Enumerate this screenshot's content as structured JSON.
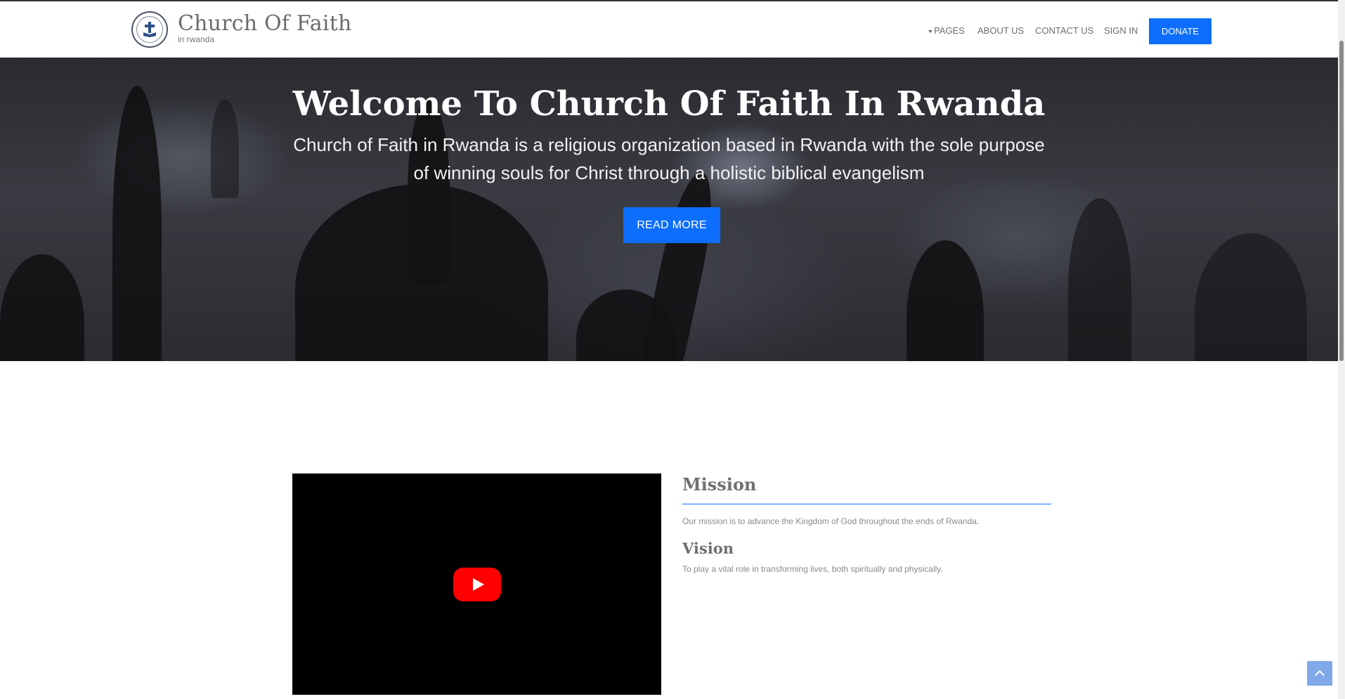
{
  "brand": {
    "title": "Church Of Faith",
    "subtitle": "in rwanda"
  },
  "nav": {
    "pages_label": "Pages",
    "about_label": "About us",
    "contact_label": "Contact us",
    "signin_label": "Sign in",
    "donate_label": "Donate"
  },
  "hero": {
    "title": "Welcome To Church Of Faith In Rwanda",
    "text": "Church of Faith in Rwanda is a religious organization based in Rwanda with the sole purpose of winning souls for Christ through a holistic biblical evangelism",
    "button_label": "Read more"
  },
  "about": {
    "mission_heading": "Mission",
    "mission_text": "Our mission is to advance the Kingdom of God throughout the ends of Rwanda.",
    "vision_heading": "Vision",
    "vision_text": "To play a vital role in transforming lives, both spiritually and physically."
  },
  "colors": {
    "accent": "#0d6efd",
    "youtube_red": "#ff0000",
    "back_to_top": "#7fa9e8"
  },
  "icons": {
    "logo": "church-logo-icon",
    "pages_caret": "caret-down-icon",
    "video_play": "youtube-play-icon",
    "back_to_top": "chevron-up-icon"
  }
}
